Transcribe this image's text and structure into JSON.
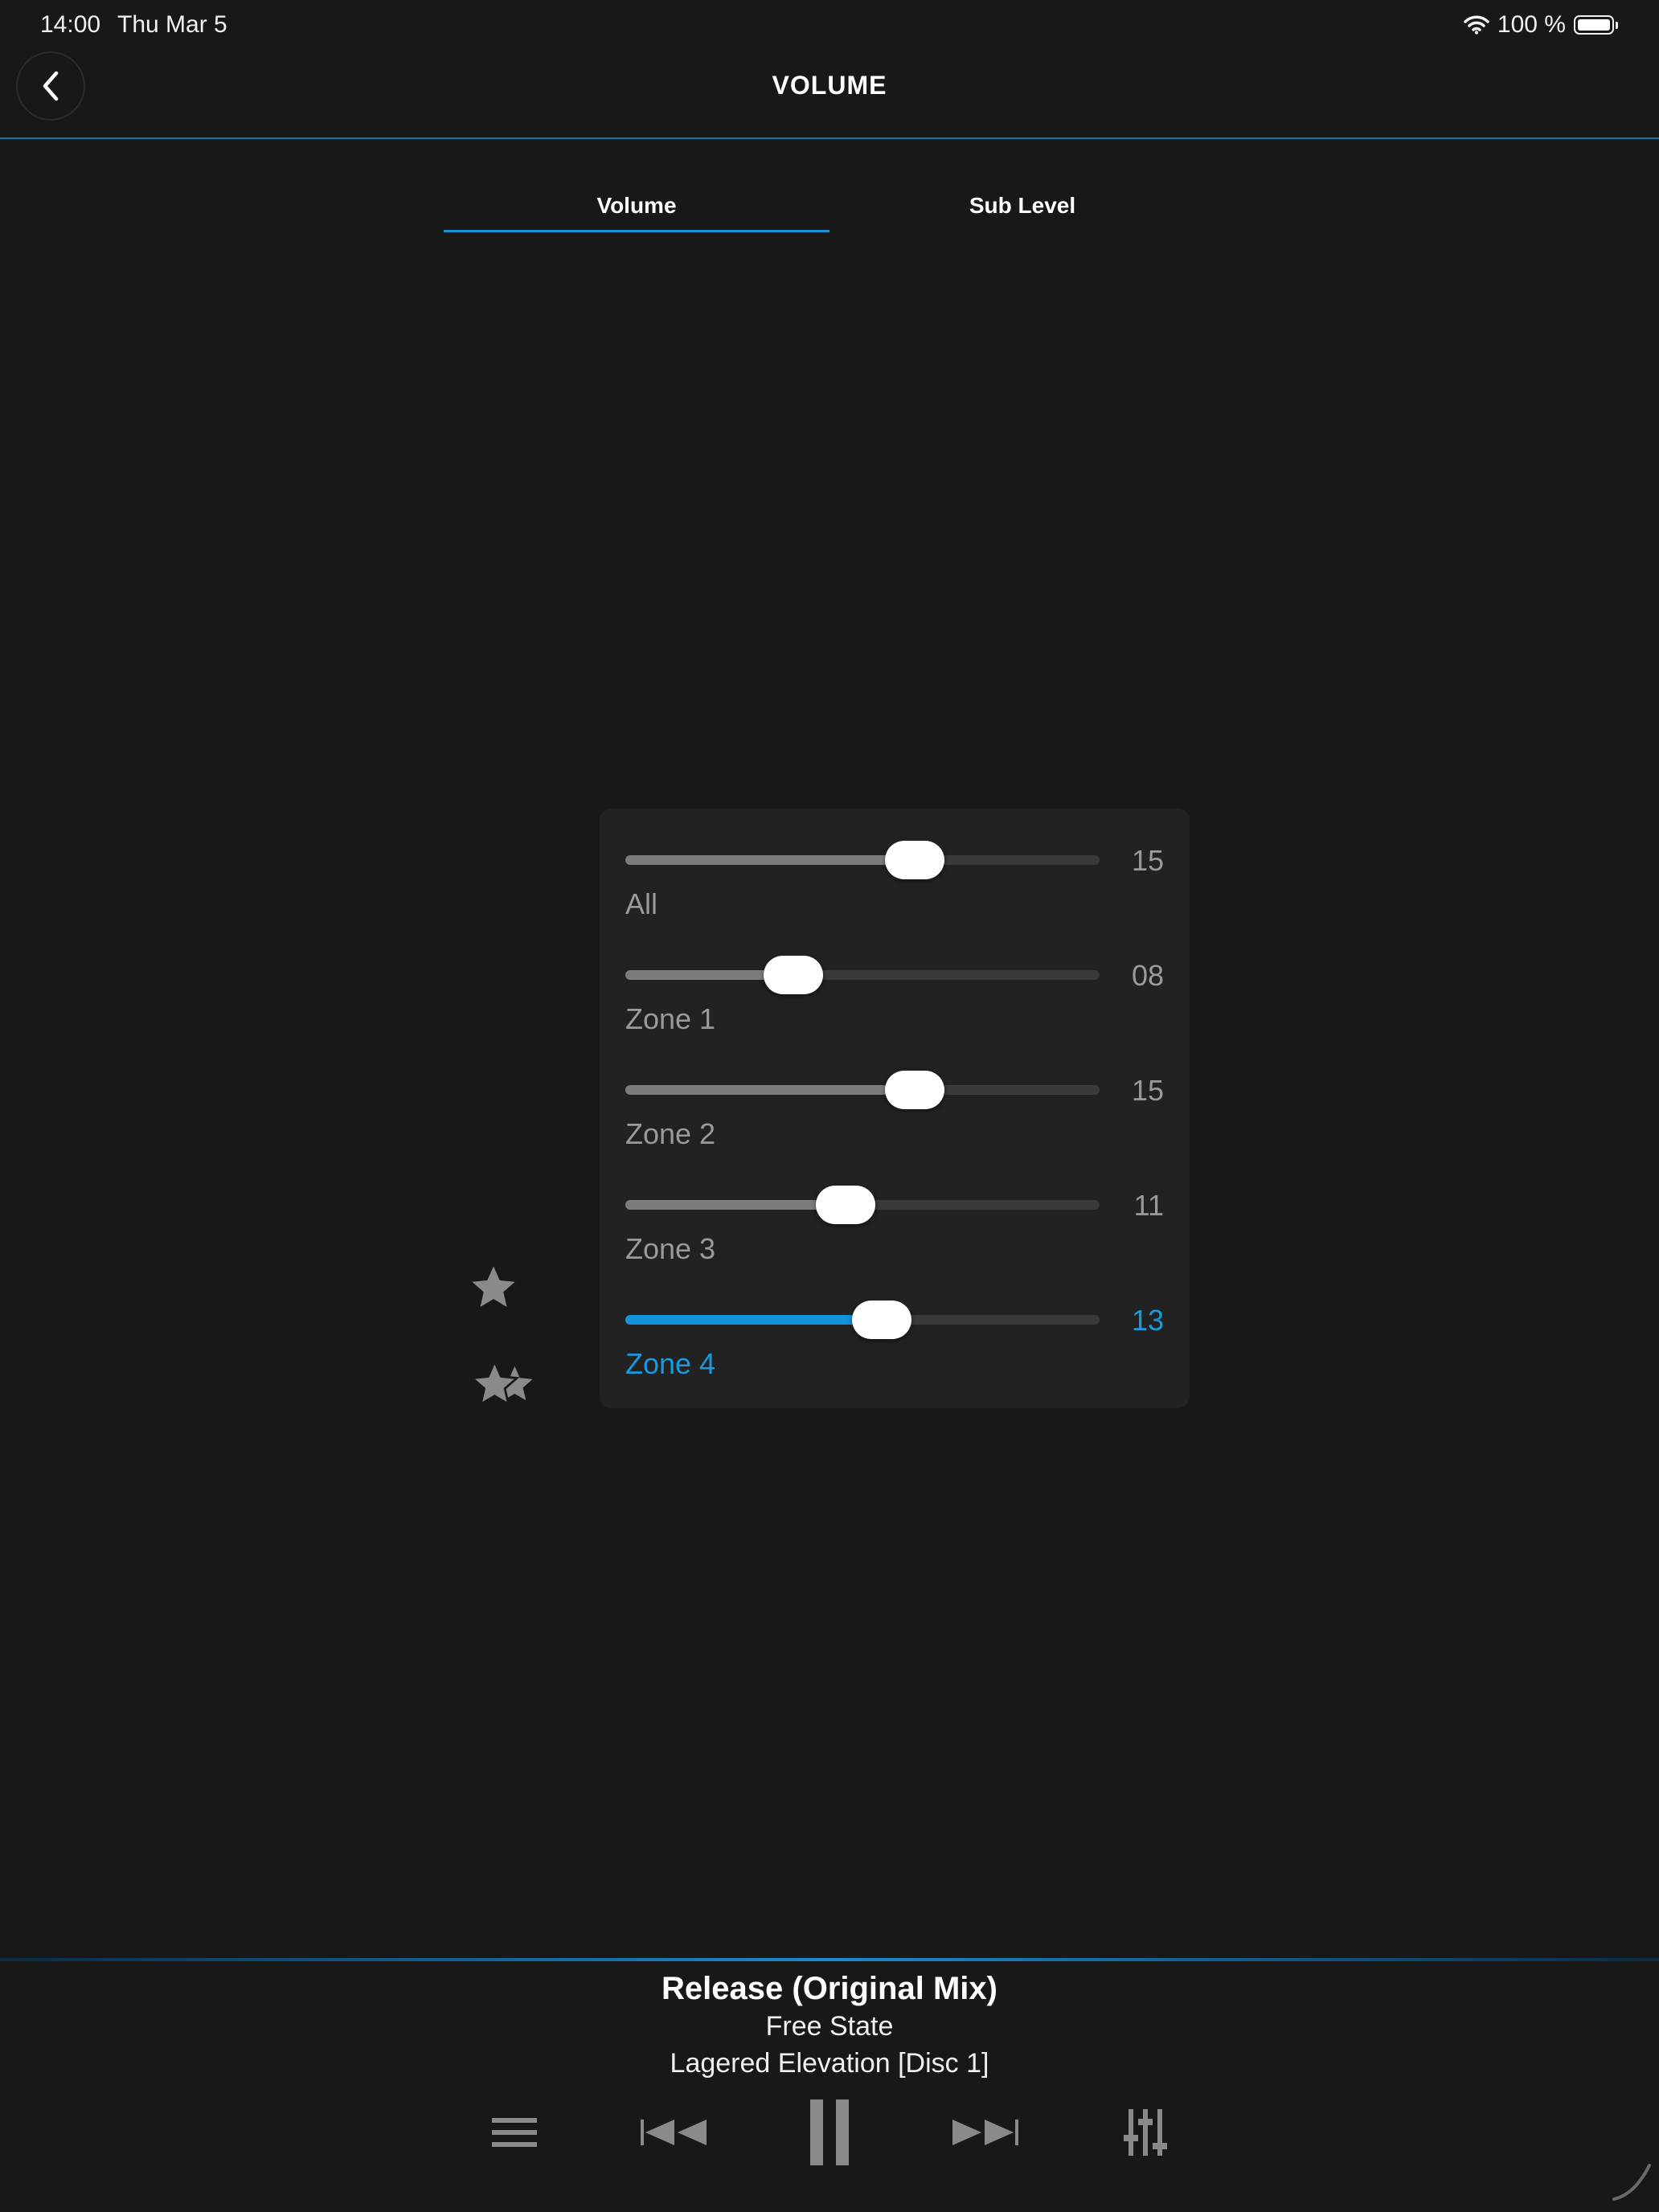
{
  "status_bar": {
    "time": "14:00",
    "date": "Thu Mar 5",
    "battery_text": "100 %",
    "battery_level": 1.0
  },
  "header": {
    "title": "VOLUME",
    "back_icon": "chevron-left-icon"
  },
  "tabs": [
    {
      "label": "Volume",
      "selected": true
    },
    {
      "label": "Sub Level",
      "selected": false
    }
  ],
  "sliders": [
    {
      "label": "All",
      "value": "15",
      "position": 0.61,
      "active": false
    },
    {
      "label": "Zone 1",
      "value": "08",
      "position": 0.355,
      "active": false
    },
    {
      "label": "Zone 2",
      "value": "15",
      "position": 0.61,
      "active": false
    },
    {
      "label": "Zone 3",
      "value": "11",
      "position": 0.465,
      "active": false
    },
    {
      "label": "Zone 4",
      "value": "13",
      "position": 0.54,
      "active": true
    }
  ],
  "favorites": {
    "single_icon": "star-icon",
    "multi_icon": "double-star-icon"
  },
  "now_playing": {
    "title": "Release (Original Mix)",
    "artist": "Free State",
    "album": "Lagered Elevation [Disc 1]"
  },
  "controls": [
    "queue-list-icon",
    "previous-track-icon",
    "pause-icon",
    "next-track-icon",
    "equalizer-icon"
  ],
  "colors": {
    "background": "#181818",
    "panel": "#222222",
    "accent": "#1a99de",
    "inactive_text": "#9a9a9a"
  }
}
